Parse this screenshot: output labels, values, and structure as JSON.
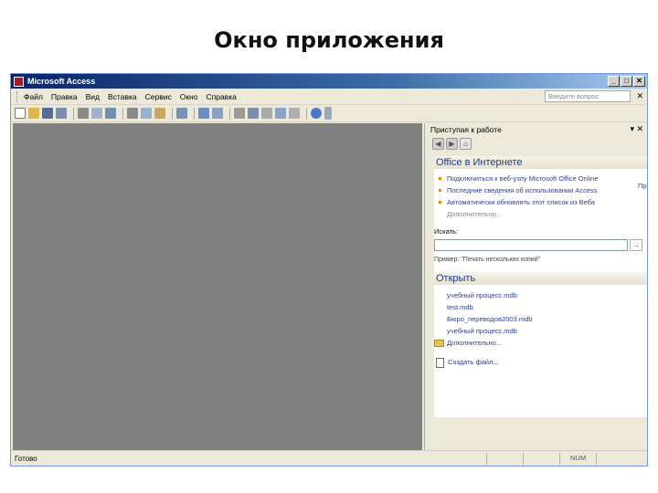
{
  "slide": {
    "title": "Окно приложения"
  },
  "window": {
    "title": "Microsoft Access",
    "buttons": {
      "minimize": "_",
      "maximize": "□",
      "close": "✕"
    }
  },
  "menu": {
    "items": [
      "Файл",
      "Правка",
      "Вид",
      "Вставка",
      "Сервис",
      "Окно",
      "Справка"
    ],
    "help_placeholder": "Введите вопрос",
    "close_glyph": "✕"
  },
  "task_pane": {
    "title": "Приступая к работе",
    "controls": "▾ ✕",
    "nav": {
      "back": "◀",
      "forward": "▶",
      "home": "⌂"
    },
    "online": {
      "title": "Office в Интернете",
      "links": [
        "Подключиться к веб-узлу Microsoft Office Online",
        "Последние сведения об использовании Access",
        "Автоматически обновлять этот список из Веба"
      ],
      "more": "Дополнительно...",
      "search_label": "Искать:",
      "go": "→",
      "example": "Пример: \"Печать нескольких копий\""
    },
    "open": {
      "title": "Открыть",
      "files": [
        "учебный процесс.mdb",
        "test.mdb",
        "Бюро_переводов2003.mdb",
        "учебный процесс.mdb"
      ],
      "more": "Дополнительно...",
      "create": "Создать файл..."
    },
    "overflow_text": "Про"
  },
  "status": {
    "ready": "Готово",
    "num": "NUM"
  }
}
